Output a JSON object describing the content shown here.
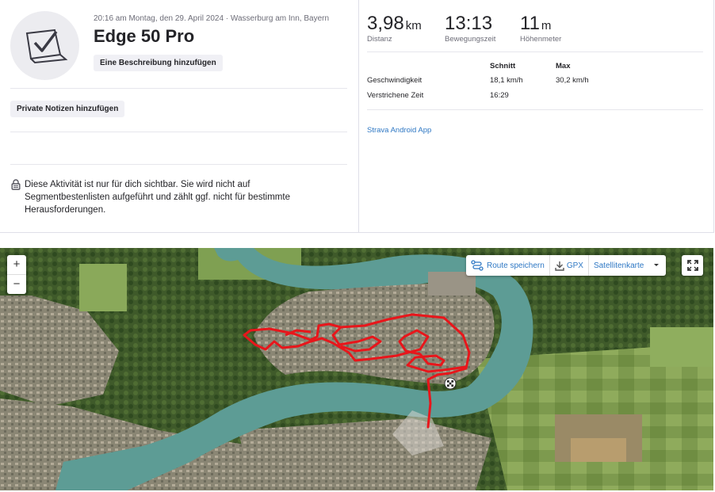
{
  "activity": {
    "meta": "20:16 am Montag, den 29. April 2024 · Wasserburg am Inn, Bayern",
    "title": "Edge 50 Pro",
    "add_description": "Eine Beschreibung hinzufügen",
    "add_private_notes": "Private Notizen hinzufügen",
    "privacy_notice": "Diese Aktivität ist nur für dich sichtbar. Sie wird nicht auf Segmentbestenlisten aufgeführt und zählt ggf. nicht für bestimmte Herausforderungen.",
    "avatar_icon": "activity-checkmark-icon"
  },
  "stats": {
    "distance": {
      "value": "3,98",
      "unit": "km",
      "label": "Distanz"
    },
    "moving_time": {
      "value": "13:13",
      "label": "Bewegungszeit"
    },
    "elevation": {
      "value": "11",
      "unit": "m",
      "label": "Höhenmeter"
    }
  },
  "details": {
    "headers": {
      "avg": "Schnitt",
      "max": "Max"
    },
    "rows": [
      {
        "label": "Geschwindigkeit",
        "avg": "18,1 km/h",
        "max": "30,2 km/h"
      },
      {
        "label": "Verstrichene Zeit",
        "avg": "16:29",
        "max": ""
      }
    ],
    "device": "Strava Android App"
  },
  "map": {
    "zoom_in": "+",
    "zoom_out": "−",
    "save_route": "Route speichern",
    "gpx": "GPX",
    "map_type": "Satellitenkarte",
    "route_color": "#e8161b",
    "river_color": "#5d9c95"
  }
}
